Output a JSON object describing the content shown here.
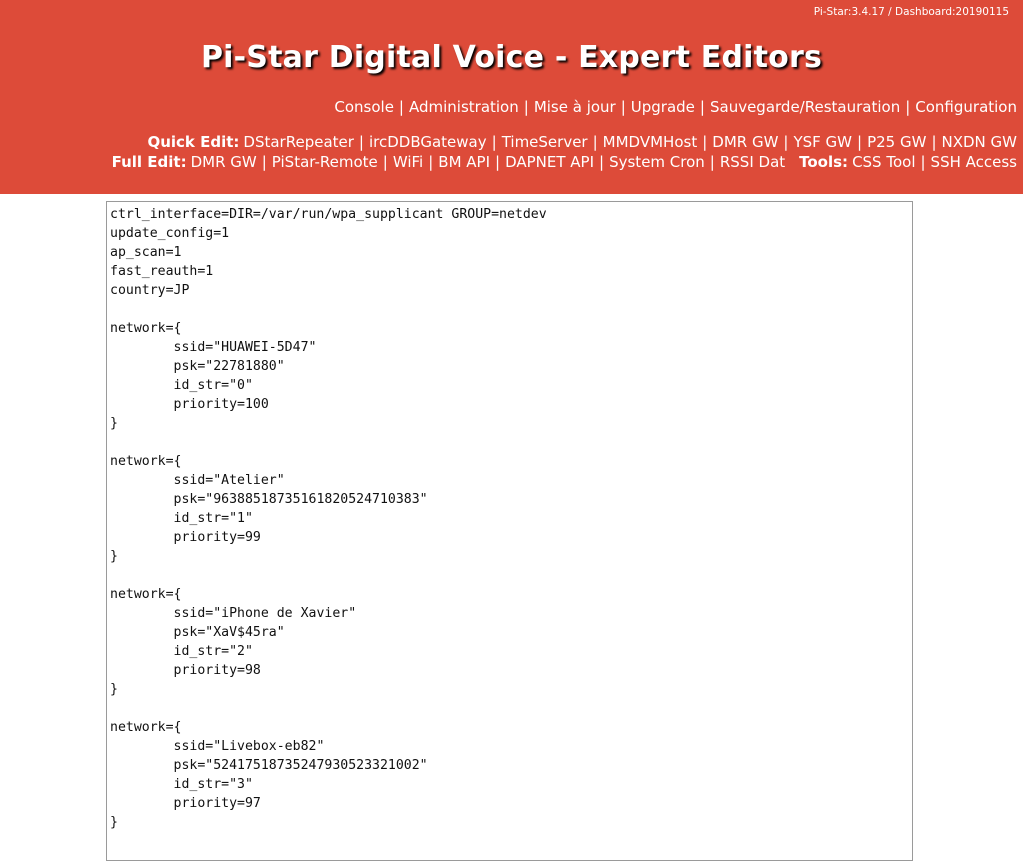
{
  "header": {
    "version": "Pi-Star:3.4.17 / Dashboard:20190115",
    "title": "Pi-Star Digital Voice - Expert Editors"
  },
  "nav_main": [
    "Console",
    "Administration",
    "Mise à jour",
    "Upgrade",
    "Sauvegarde/Restauration",
    "Configuration"
  ],
  "quick_edit": {
    "label": "Quick Edit:",
    "links": [
      "DStarRepeater",
      "ircDDBGateway",
      "TimeServer",
      "MMDVMHost",
      "DMR GW",
      "YSF GW",
      "P25 GW",
      "NXDN GW"
    ]
  },
  "full_edit": {
    "label": "Full Edit:",
    "links": [
      "DMR GW",
      "PiStar-Remote",
      "WiFi",
      "BM API",
      "DAPNET API",
      "System Cron",
      "RSSI Dat"
    ]
  },
  "tools": {
    "label": "Tools:",
    "links": [
      "CSS Tool",
      "SSH Access"
    ]
  },
  "editor": {
    "content": "ctrl_interface=DIR=/var/run/wpa_supplicant GROUP=netdev\nupdate_config=1\nap_scan=1\nfast_reauth=1\ncountry=JP\n\nnetwork={\n\tssid=\"HUAWEI-5D47\"\n\tpsk=\"22781880\"\n\tid_str=\"0\"\n\tpriority=100\n}\n\nnetwork={\n\tssid=\"Atelier\"\n\tpsk=\"96388518735161820524710383\"\n\tid_str=\"1\"\n\tpriority=99\n}\n\nnetwork={\n\tssid=\"iPhone de Xavier\"\n\tpsk=\"XaV$45ra\"\n\tid_str=\"2\"\n\tpriority=98\n}\n\nnetwork={\n\tssid=\"Livebox-eb82\"\n\tpsk=\"52417518735247930523321002\"\n\tid_str=\"3\"\n\tpriority=97\n}"
  }
}
